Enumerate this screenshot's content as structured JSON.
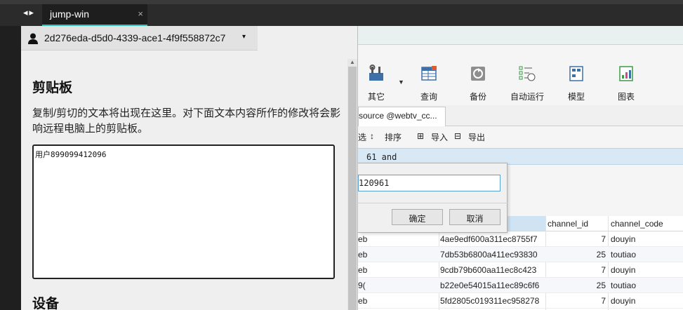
{
  "tab": {
    "label": "jump-win",
    "close": "×",
    "nav": "◂▸"
  },
  "connection": {
    "id": "2d276eda-d5d0-4339-ace1-4f9f558872c7",
    "caret": "▾"
  },
  "clipboard": {
    "title": "剪贴板",
    "description": "复制/剪切的文本将出现在这里。对下面文本内容所作的修改将会影响远程电脑上的剪贴板。",
    "content": "用户899099412096"
  },
  "devices": {
    "title": "设备"
  },
  "remote": {
    "toolbar": [
      {
        "label": "其它",
        "icon": "tools-icon"
      },
      {
        "label": "查询",
        "icon": "query-icon"
      },
      {
        "label": "备份",
        "icon": "backup-icon"
      },
      {
        "label": "自动运行",
        "icon": "autorun-icon"
      },
      {
        "label": "模型",
        "icon": "model-icon"
      },
      {
        "label": "图表",
        "icon": "chart-icon"
      }
    ],
    "doc_tab": "source @webtv_cc...",
    "subtoolbar": {
      "filter": "选",
      "sort": "排序",
      "import": "导入",
      "export": "导出"
    },
    "filter_text": "61 and",
    "dialog": {
      "input_value": "120961",
      "ok": "确定",
      "cancel": "取消"
    },
    "grid": {
      "columns": [
        "channel_id",
        "channel_code"
      ],
      "rows": [
        {
          "c0": "eb",
          "c1": "4ae9edf600a311ec8755f7",
          "c2": "7",
          "c3": "douyin"
        },
        {
          "c0": "eb",
          "c1": "7db53b6800a411ec93830",
          "c2": "25",
          "c3": "toutiao"
        },
        {
          "c0": "eb",
          "c1": "9cdb79b600aa11ec8c423",
          "c2": "7",
          "c3": "douyin"
        },
        {
          "c0": "9(",
          "c1": "b22e0e54015a11ec89c6f6",
          "c2": "25",
          "c3": "toutiao"
        },
        {
          "c0": "eb",
          "c1": "5fd2805c019311ec958278",
          "c2": "7",
          "c3": "douyin"
        }
      ]
    }
  }
}
